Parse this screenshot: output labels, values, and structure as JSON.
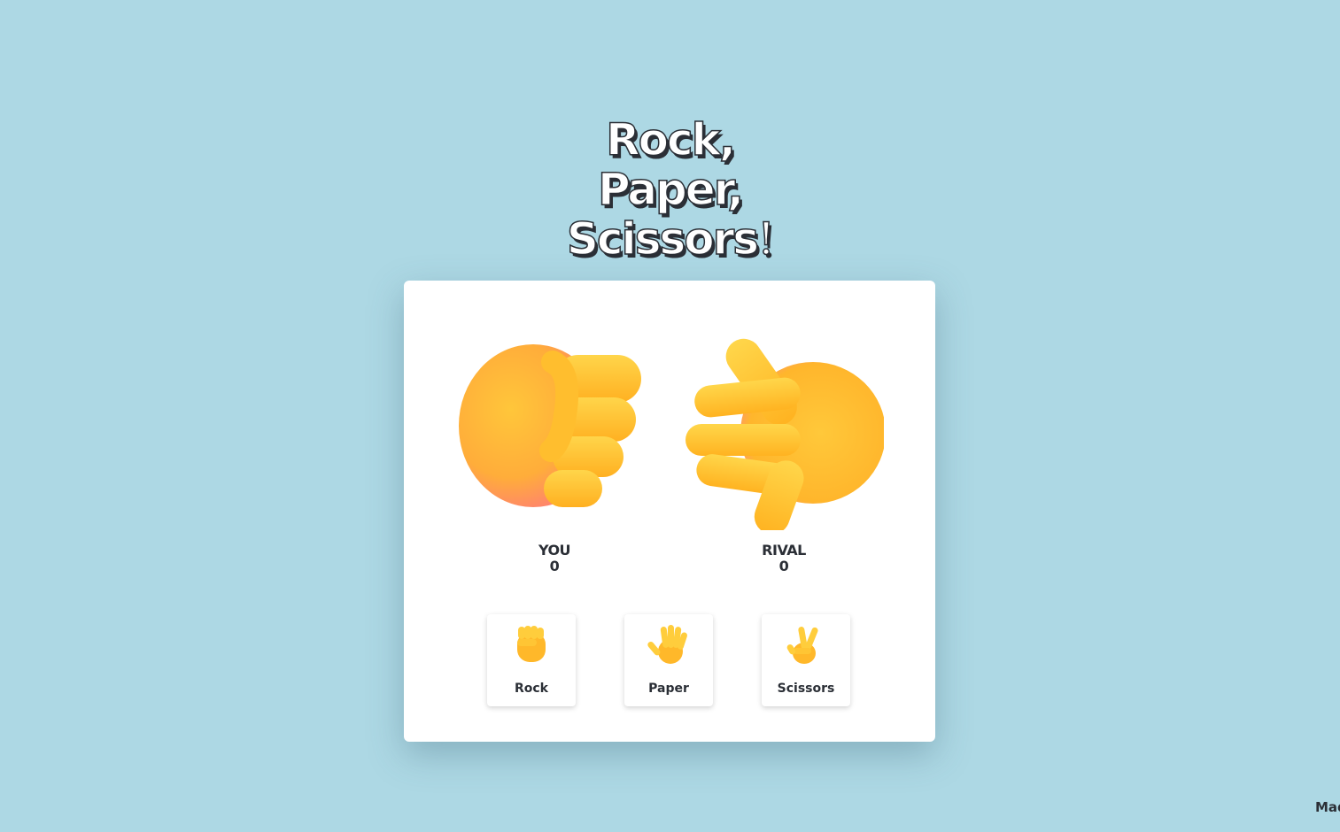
{
  "title": {
    "line1": "Rock,",
    "line2": "Paper,",
    "line3": "Scissors",
    "bang": "!"
  },
  "players": {
    "you": {
      "label": "YOU",
      "score": "0",
      "hand": "rock-hand-icon"
    },
    "rival": {
      "label": "RIVAL",
      "score": "0",
      "hand": "paper-hand-icon"
    }
  },
  "choices": [
    {
      "label": "Rock",
      "icon": "raised-fist-icon"
    },
    {
      "label": "Paper",
      "icon": "raised-hand-icon"
    },
    {
      "label": "Scissors",
      "icon": "victory-hand-icon"
    }
  ],
  "footer": {
    "text": "Mad"
  },
  "colors": {
    "background": "#add8e4",
    "card": "#ffffff",
    "text": "#2b2f36",
    "hand_yellow": "#ffc02a"
  }
}
